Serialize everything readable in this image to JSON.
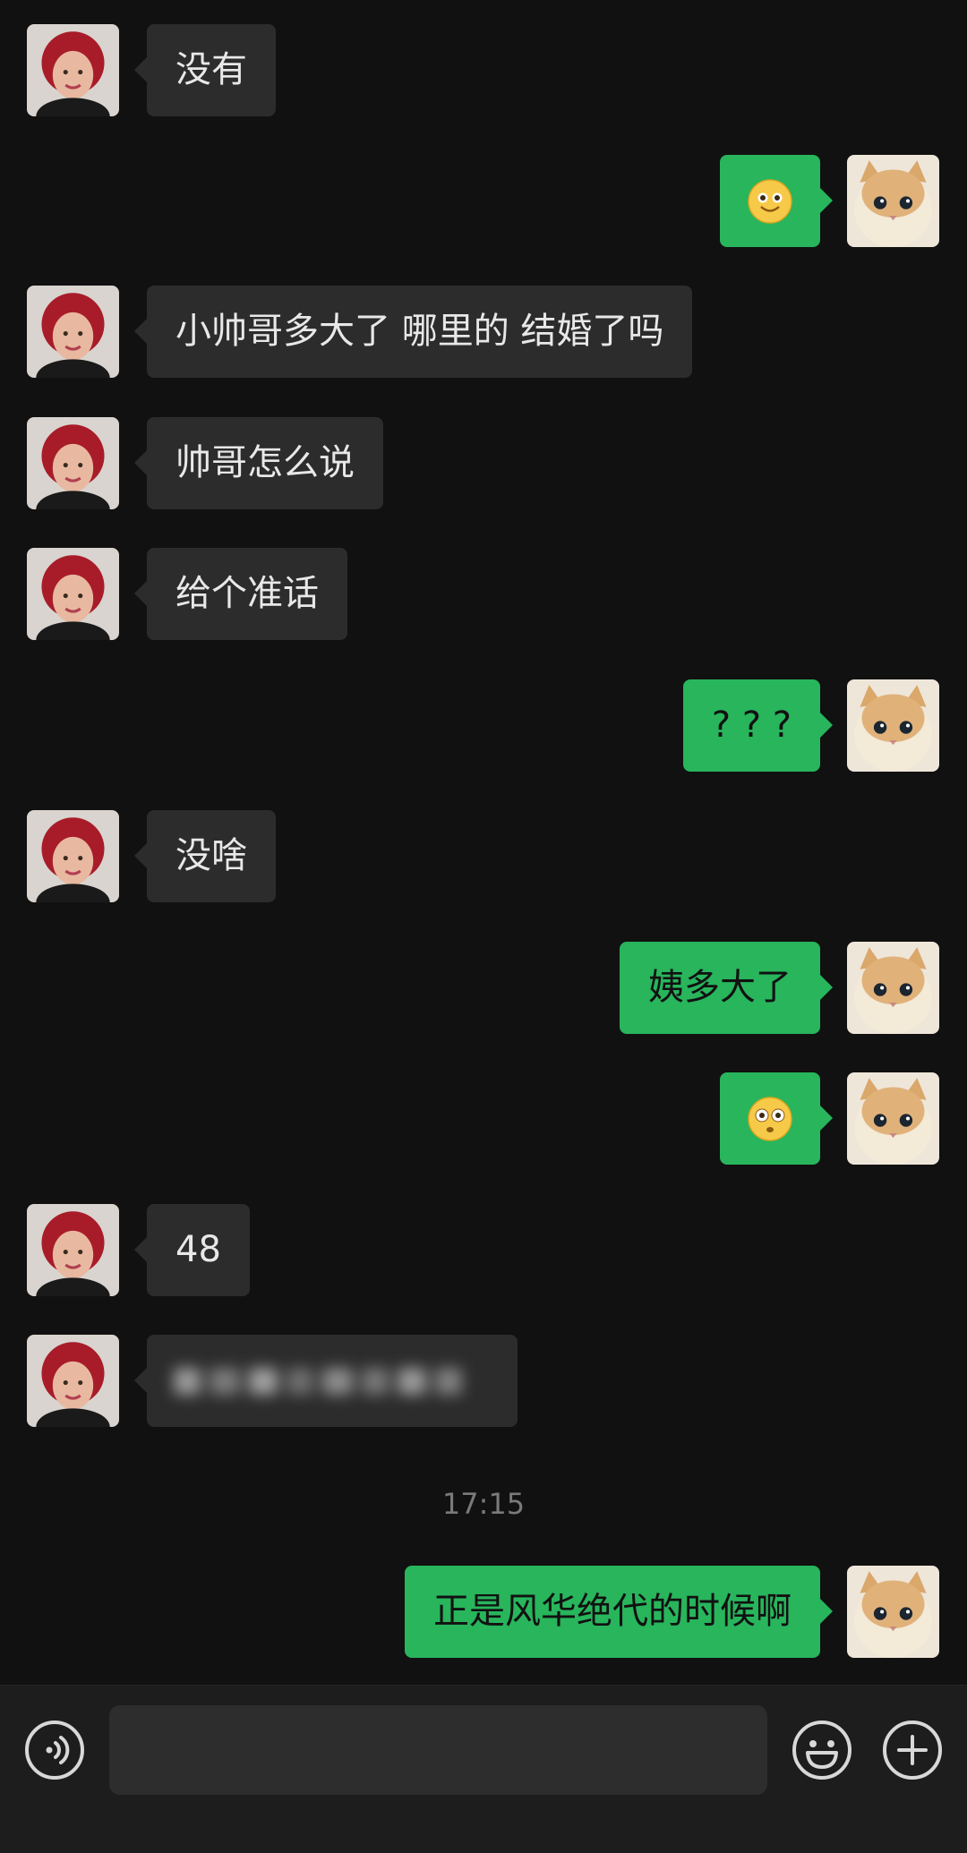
{
  "colors": {
    "background": "#111111",
    "incoming_bubble": "#2c2c2c",
    "outgoing_bubble": "#28b55c",
    "timestamp_text": "#7a7a7a"
  },
  "messages": [
    {
      "direction": "incoming",
      "text": "没有"
    },
    {
      "direction": "outgoing",
      "emoji": "smile-emoji"
    },
    {
      "direction": "incoming",
      "text": "小帅哥多大了 哪里的 结婚了吗"
    },
    {
      "direction": "incoming",
      "text": "帅哥怎么说"
    },
    {
      "direction": "incoming",
      "text": "给个准话"
    },
    {
      "direction": "outgoing",
      "text": "? ? ?"
    },
    {
      "direction": "incoming",
      "text": "没啥"
    },
    {
      "direction": "outgoing",
      "text": "姨多大了"
    },
    {
      "direction": "outgoing",
      "emoji": "flushed-emoji"
    },
    {
      "direction": "incoming",
      "text": "48"
    },
    {
      "direction": "incoming",
      "text": "",
      "blurred": true
    },
    {
      "direction": "outgoing",
      "text": "正是风华绝代的时候啊"
    }
  ],
  "timestamp": "17:15",
  "input_bar": {
    "voice_icon": "voice-icon",
    "emoji_icon": "emoji-icon",
    "more_icon": "plus-icon",
    "input_value": ""
  }
}
